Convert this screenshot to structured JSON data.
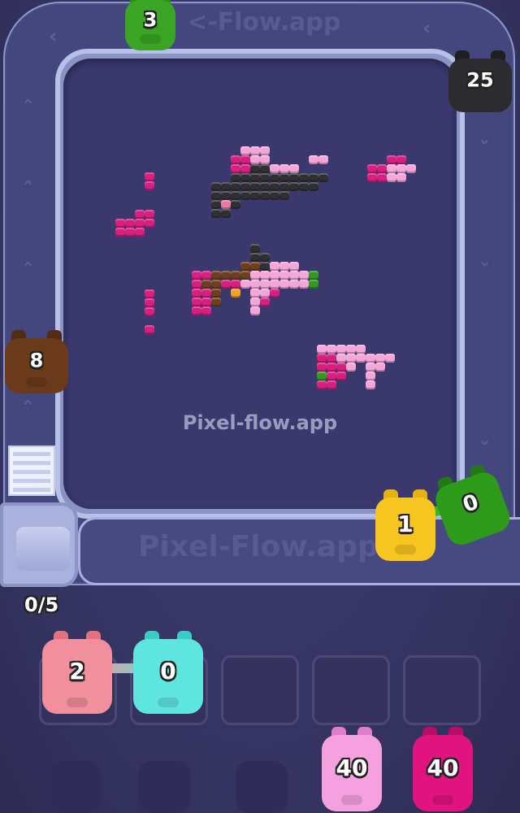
{
  "watermark": "Pixel-flow.app",
  "watermark_lane": "Pixel-Flow.app",
  "watermark_top": "<-Flow.app",
  "progress_counter": "0/5",
  "conveyor_pigs": [
    {
      "id": "green-top",
      "color": "#3aa524",
      "count": "3"
    },
    {
      "id": "black-right",
      "color": "#2b2b30",
      "count": "25"
    },
    {
      "id": "brown-left",
      "color": "#6a3a1b",
      "count": "8"
    },
    {
      "id": "yellow",
      "color": "#f7c51f",
      "count": "1"
    },
    {
      "id": "green-corner",
      "color": "#2e9a1a",
      "count": "0"
    }
  ],
  "holding_slots": [
    {
      "pig": {
        "color": "#f28f9c",
        "count": "2"
      }
    },
    {
      "pig": {
        "color": "#5fe5e0",
        "count": "0"
      }
    },
    {
      "pig": null
    },
    {
      "pig": null
    },
    {
      "pig": null
    }
  ],
  "queue_pigs": [
    {
      "color": "#f5a0df",
      "count": "40"
    },
    {
      "color": "#e0137f",
      "count": "40"
    }
  ]
}
